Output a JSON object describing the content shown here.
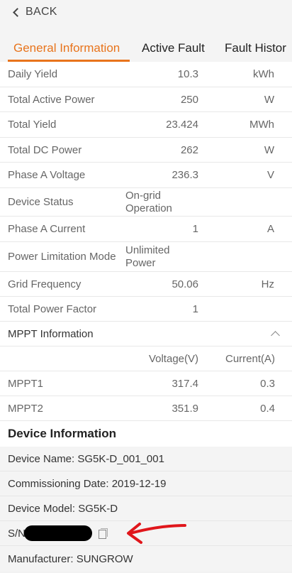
{
  "nav": {
    "back_label": "BACK"
  },
  "tabs": [
    "General Information",
    "Active Fault",
    "Fault Histor"
  ],
  "general": [
    {
      "label": "Daily Yield",
      "value": "10.3",
      "unit": "kWh"
    },
    {
      "label": "Total Active Power",
      "value": "250",
      "unit": "W"
    },
    {
      "label": "Total Yield",
      "value": "23.424",
      "unit": "MWh"
    },
    {
      "label": "Total DC Power",
      "value": "262",
      "unit": "W"
    },
    {
      "label": "Phase A Voltage",
      "value": "236.3",
      "unit": "V"
    },
    {
      "label": "Device Status",
      "value": "On-grid Operation",
      "unit": ""
    },
    {
      "label": "Phase A Current",
      "value": "1",
      "unit": "A"
    },
    {
      "label": "Power Limitation Mode",
      "value": "Unlimited Power",
      "unit": ""
    },
    {
      "label": "Grid Frequency",
      "value": "50.06",
      "unit": "Hz"
    },
    {
      "label": "Total Power Factor",
      "value": "1",
      "unit": ""
    }
  ],
  "mppt": {
    "title": "MPPT Information",
    "col_voltage": "Voltage(V)",
    "col_current": "Current(A)",
    "rows": [
      {
        "name": "MPPT1",
        "voltage": "317.4",
        "current": "0.3"
      },
      {
        "name": "MPPT2",
        "voltage": "351.9",
        "current": "0.4"
      }
    ]
  },
  "device_info": {
    "title": "Device Information",
    "name": "Device Name: SG5K-D_001_001",
    "commissioning": "Commissioning Date: 2019-12-19",
    "model": "Device Model: SG5K-D",
    "sn_label": "S/N",
    "manufacturer": "Manufacturer: SUNGROW"
  },
  "colors": {
    "accent": "#e8741c",
    "annotation": "#e0161b"
  },
  "icons": [
    "chevron-left-icon",
    "chevron-up-icon",
    "copy-icon",
    "red-arrow-annotation"
  ]
}
